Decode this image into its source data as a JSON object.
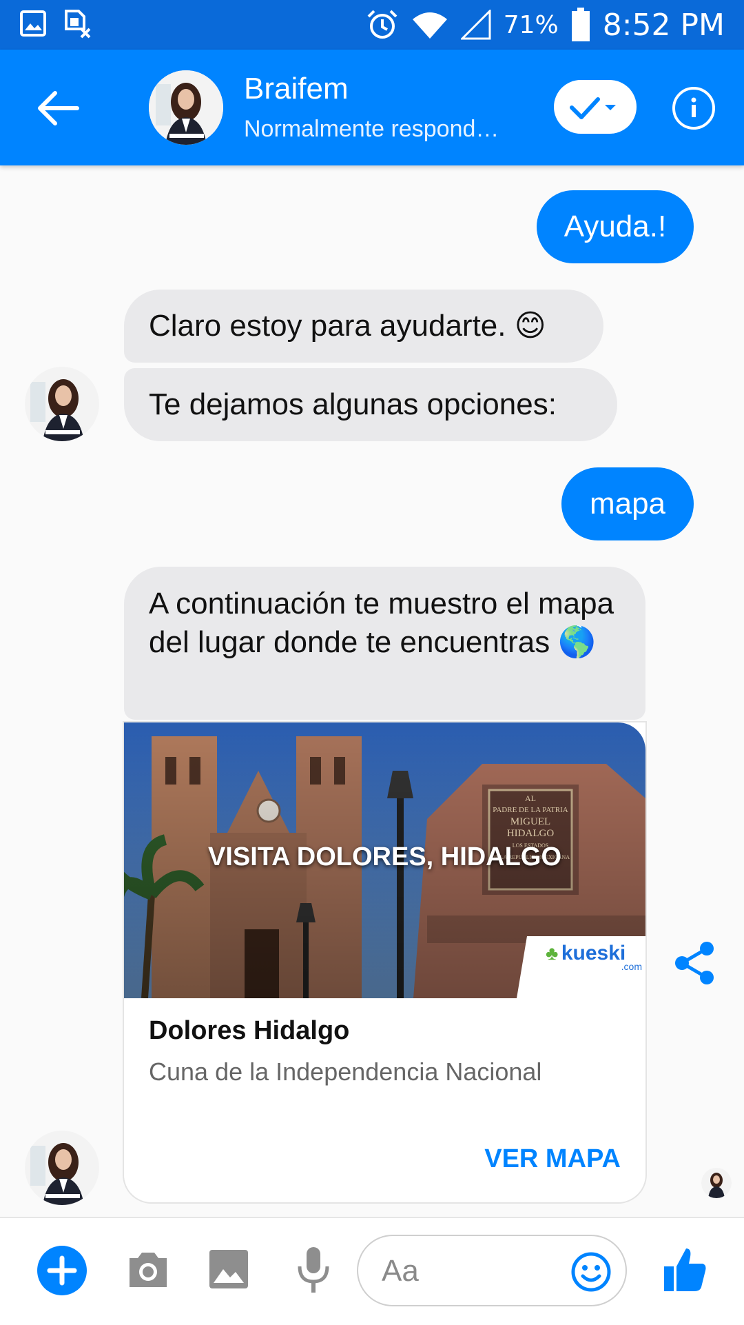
{
  "status": {
    "battery_pct": "71%",
    "time": "8:52 PM"
  },
  "header": {
    "contact_name": "Braifem",
    "subtitle": "Normalmente respond…"
  },
  "messages": [
    {
      "side": "out",
      "text": "Ayuda.!"
    },
    {
      "side": "in",
      "text": "Claro estoy para ayudarte. 😊"
    },
    {
      "side": "in",
      "text": "Te dejamos algunas opciones:"
    },
    {
      "side": "out",
      "text": "mapa"
    },
    {
      "side": "in",
      "text": "A continuación te muestro el mapa del lugar donde te encuentras 🌎"
    }
  ],
  "card": {
    "image_caption": "VISITA DOLORES, HIDALGO",
    "image_brand": "kueski",
    "image_brand_sub": ".com",
    "plaque_lines": [
      "AL",
      "PADRE DE LA PATRIA",
      "MIGUEL HIDALGO",
      "LOS ESTADOS",
      "DE LA REPUBLICA MEXICANA"
    ],
    "title": "Dolores Hidalgo",
    "subtitle": "Cuna de la Independencia Nacional",
    "action": "VER MAPA"
  },
  "composer": {
    "placeholder": "Aa"
  },
  "colors": {
    "messenger_blue": "#0084ff",
    "status_bar": "#0a6ad9",
    "incoming_bubble": "#e9e9eb"
  },
  "icons": {
    "status_left": [
      "gallery-icon",
      "sim-off-icon"
    ],
    "status_right": [
      "alarm-icon",
      "wifi-icon",
      "signal-icon",
      "battery-icon"
    ]
  }
}
